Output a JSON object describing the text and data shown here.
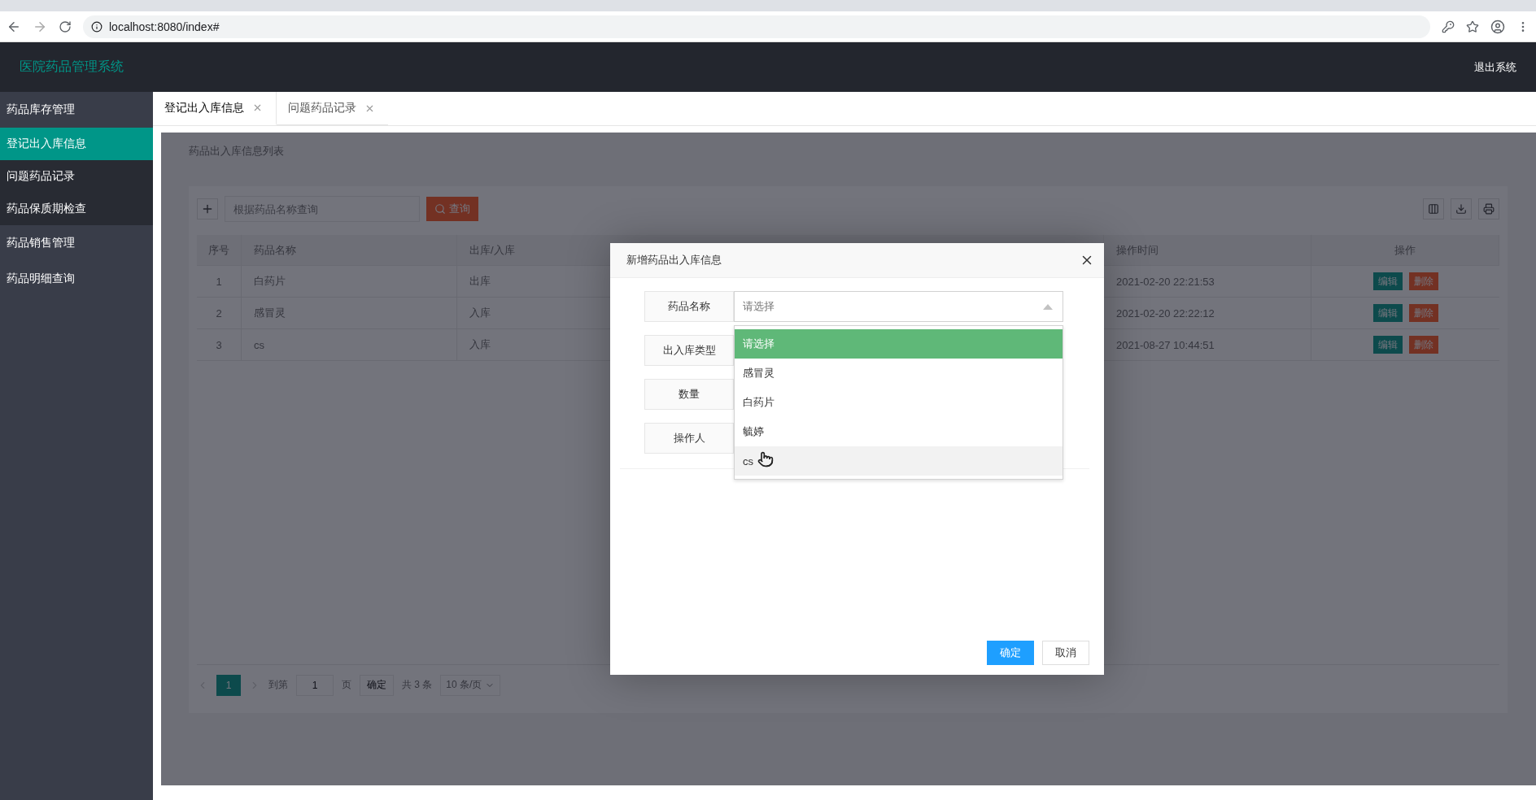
{
  "browser": {
    "url": "localhost:8080/index#"
  },
  "header": {
    "title": "医院药品管理系统",
    "logout": "退出系统"
  },
  "sidebar": {
    "items": [
      {
        "label": "药品库存管理",
        "kind": "group",
        "selected": false
      },
      {
        "label": "登记出入库信息",
        "kind": "child",
        "selected": true
      },
      {
        "label": "问题药品记录",
        "kind": "child",
        "selected": false
      },
      {
        "label": "药品保质期检查",
        "kind": "child",
        "selected": false
      },
      {
        "label": "药品销售管理",
        "kind": "group",
        "selected": false
      },
      {
        "label": "药品明细查询",
        "kind": "group",
        "selected": false
      }
    ]
  },
  "tabs": [
    {
      "label": "登记出入库信息",
      "selected": true
    },
    {
      "label": "问题药品记录",
      "selected": false
    }
  ],
  "page": {
    "title": "药品出入库信息列表",
    "search": {
      "placeholder": "根据药品名称查询",
      "button": "查询"
    },
    "table": {
      "columns": [
        "序号",
        "药品名称",
        "出库/入库",
        "操作时间",
        "操作"
      ],
      "rows": [
        {
          "no": "1",
          "name": "白药片",
          "type": "出库",
          "time": "2021-02-20 22:21:53",
          "actions": [
            "编辑",
            "删除"
          ]
        },
        {
          "no": "2",
          "name": "感冒灵",
          "type": "入库",
          "time": "2021-02-20 22:22:12",
          "actions": [
            "编辑",
            "删除"
          ]
        },
        {
          "no": "3",
          "name": "cs",
          "type": "入库",
          "time": "2021-08-27 10:44:51",
          "actions": [
            "编辑",
            "删除"
          ]
        }
      ]
    },
    "pagination": {
      "pages": [
        {
          "label": "1",
          "selected": true
        }
      ],
      "goto": "到第",
      "page_input": "1",
      "page_unit": "页",
      "confirm": "确定",
      "total": "共 3 条",
      "page_size": "10 条/页"
    }
  },
  "dialog": {
    "title": "新增药品出入库信息",
    "fields": [
      {
        "label": "药品名称",
        "kind": "select",
        "placeholder": "请选择",
        "expanded": true
      },
      {
        "label": "出入库类型"
      },
      {
        "label": "数量"
      },
      {
        "label": "操作人"
      }
    ],
    "options": [
      {
        "label": "请选择",
        "selected": true,
        "hovered": false
      },
      {
        "label": "感冒灵",
        "selected": false,
        "hovered": false
      },
      {
        "label": "白药片",
        "selected": false,
        "hovered": false
      },
      {
        "label": "毓婷",
        "selected": false,
        "hovered": false
      },
      {
        "label": "cs",
        "selected": false,
        "hovered": true
      }
    ],
    "confirm": "确定",
    "cancel": "取消"
  }
}
